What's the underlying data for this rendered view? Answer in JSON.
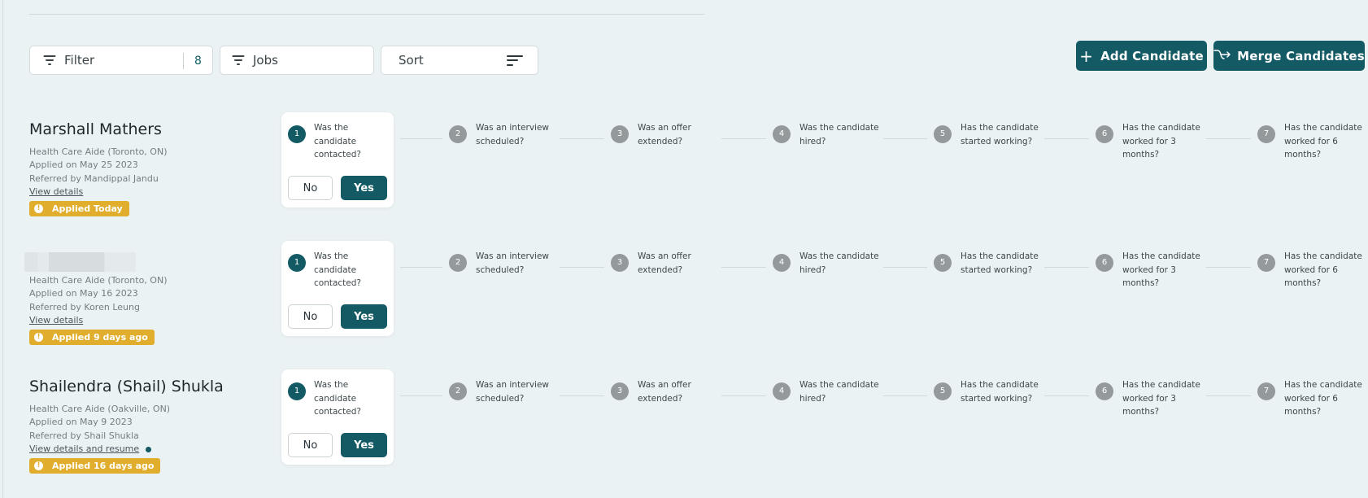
{
  "toolbar": {
    "filter_label": "Filter",
    "filter_count": "8",
    "jobs_label": "Jobs",
    "sort_label": "Sort",
    "add_candidate_label": "Add Candidate",
    "merge_candidates_label": "Merge Candidates"
  },
  "steps": [
    {
      "num": "1",
      "text": "Was the candidate contacted?"
    },
    {
      "num": "2",
      "text": "Was an interview scheduled?"
    },
    {
      "num": "3",
      "text": "Was an offer extended?"
    },
    {
      "num": "4",
      "text": "Was the candidate hired?"
    },
    {
      "num": "5",
      "text": "Has the candidate started working?"
    },
    {
      "num": "6",
      "text": "Has the candidate worked for 3 months?"
    },
    {
      "num": "7",
      "text": "Has the candidate worked for 6 months?"
    }
  ],
  "answers": {
    "no": "No",
    "yes": "Yes"
  },
  "candidates": [
    {
      "name": "Marshall Mathers",
      "job": "Health Care Aide (Toronto, ON)",
      "applied": "Applied on May 25 2023",
      "referred": "Referred by Mandippal Jandu",
      "link": "View details",
      "badge": "Applied Today"
    },
    {
      "name": "",
      "job": "Health Care Aide (Toronto, ON)",
      "applied": "Applied on May 16 2023",
      "referred": "Referred by Koren Leung",
      "link": "View details",
      "badge": "Applied 9 days ago"
    },
    {
      "name": "Shailendra (Shail) Shukla",
      "job": "Health Care Aide (Oakville, ON)",
      "applied": "Applied on May 9 2023",
      "referred": "Referred by Shail Shukla",
      "link": "View details and resume",
      "badge": "Applied 16 days ago"
    }
  ],
  "icons": {
    "filter": "filter-funnel-icon",
    "sort": "sort-lines-icon",
    "add": "plus-icon",
    "merge": "merge-arrow-icon",
    "badge": "alert-circle-icon"
  },
  "colors": {
    "background": "#ebf2f4",
    "primary": "#135a64",
    "badge": "#e0ae2c",
    "inactive_step": "#949a9c"
  }
}
